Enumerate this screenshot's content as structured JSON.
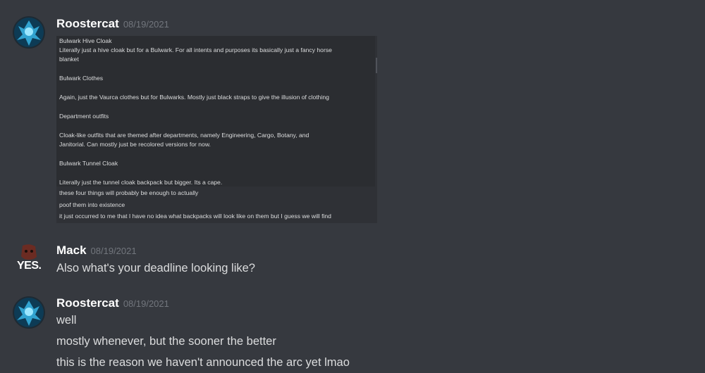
{
  "messages": [
    {
      "username": "Roostercat",
      "timestamp": "08/19/2021",
      "embed_lines": [
        "Bulwark Hive Cloak",
        "Literally just a hive cloak but for a Bulwark. For all intents and purposes its basically just a fancy horse",
        "blanket",
        "Bulwark Clothes",
        "Again, just the Vaurca clothes but for Bulwarks. Mostly just black straps to give the illusion of clothing",
        "Department outfits",
        "Cloak-like outfits that are themed after departments, namely Engineering, Cargo, Botany, and",
        "Janitorial. Can mostly just be recolored versions for now.",
        "Bulwark Tunnel Cloak",
        "Literally just the tunnel cloak backpack but bigger. Its a cape.",
        "these four things will probably be enough to actually",
        "poof them into existence",
        "it just occurred to me that I have no idea what backpacks will look like on them but I guess we will find"
      ]
    },
    {
      "username": "Mack",
      "timestamp": "08/19/2021",
      "avatar_text": "YES.",
      "lines": [
        "Also what's your deadline looking like?"
      ]
    },
    {
      "username": "Roostercat",
      "timestamp": "08/19/2021",
      "lines": [
        "well",
        "mostly whenever, but the sooner the better",
        "this is the reason we haven't announced the arc yet lmao"
      ]
    }
  ],
  "colors": {
    "background": "#36393f",
    "username": "#ffffff",
    "timestamp": "#72767d",
    "text": "#dcddde"
  }
}
